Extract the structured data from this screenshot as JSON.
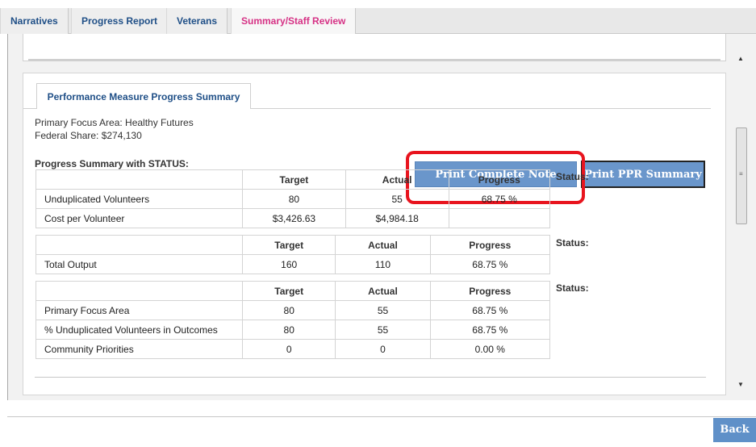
{
  "tabs": [
    {
      "label": "Narratives"
    },
    {
      "label": "Progress Report"
    },
    {
      "label": "Veterans"
    },
    {
      "label": "Summary/Staff Review"
    }
  ],
  "panel": {
    "title": "Performance Measure Progress Summary",
    "primary_focus": "Primary Focus Area: Healthy Futures",
    "federal_share": "Federal Share: $274,130",
    "summary_heading": "Progress Summary with STATUS:",
    "print_history_label": "Print Complete Note History",
    "print_ppr_label": "Print PPR Summary",
    "status_label": "Status:"
  },
  "headers": {
    "target": "Target",
    "actual": "Actual",
    "progress": "Progress"
  },
  "tables": [
    {
      "rows": [
        {
          "label": "Unduplicated Volunteers",
          "target": "80",
          "actual": "55",
          "progress": "68.75 %"
        },
        {
          "label": "Cost per Volunteer",
          "target": "$3,426.63",
          "actual": "$4,984.18",
          "progress": ""
        }
      ]
    },
    {
      "rows": [
        {
          "label": "Total Output",
          "target": "160",
          "actual": "110",
          "progress": "68.75 %"
        }
      ]
    },
    {
      "rows": [
        {
          "label": "Primary Focus Area",
          "target": "80",
          "actual": "55",
          "progress": "68.75 %"
        },
        {
          "label": "% Unduplicated Volunteers in Outcomes",
          "target": "80",
          "actual": "55",
          "progress": "68.75 %"
        },
        {
          "label": "Community Priorities",
          "target": "0",
          "actual": "0",
          "progress": "0.00 %"
        }
      ]
    }
  ],
  "footer": {
    "back_label": "Back"
  },
  "colors": {
    "tab_link": "#1f4f87",
    "tab_active": "#d63185",
    "button": "#6a96cb",
    "highlight": "#e8141e"
  }
}
